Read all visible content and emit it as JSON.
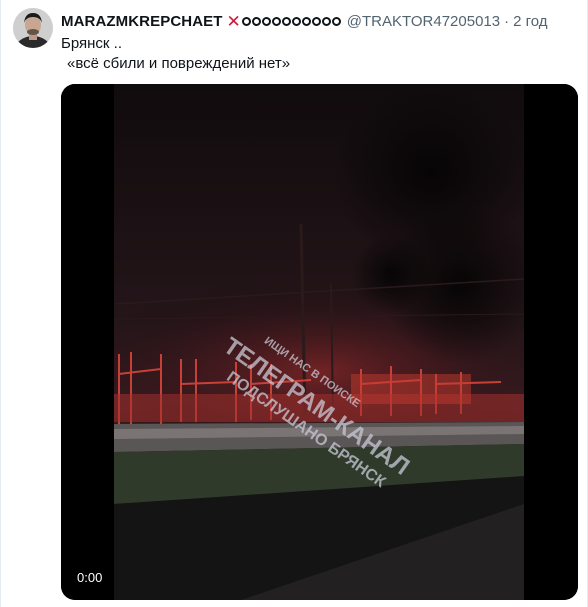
{
  "tweet": {
    "display_name": "MARAZMKREPCHAET",
    "badge_icon": "cross-icon",
    "badge_color": "#d0183c",
    "ring_icons_count": 10,
    "handle": "@TRAKTOR47205013",
    "separator": "·",
    "time": "2 год",
    "text_line1": "Брянск ..",
    "text_line2": "«всё сбили и повреждений нет»"
  },
  "video": {
    "timecode": "0:00",
    "watermark": {
      "top": "ИЩИ НАС В ПОИСКЕ",
      "main": "ТЕЛЕГРАМ-КАНАЛ",
      "bottom": "ПОДСЛУШАНО БРЯНСК"
    }
  }
}
